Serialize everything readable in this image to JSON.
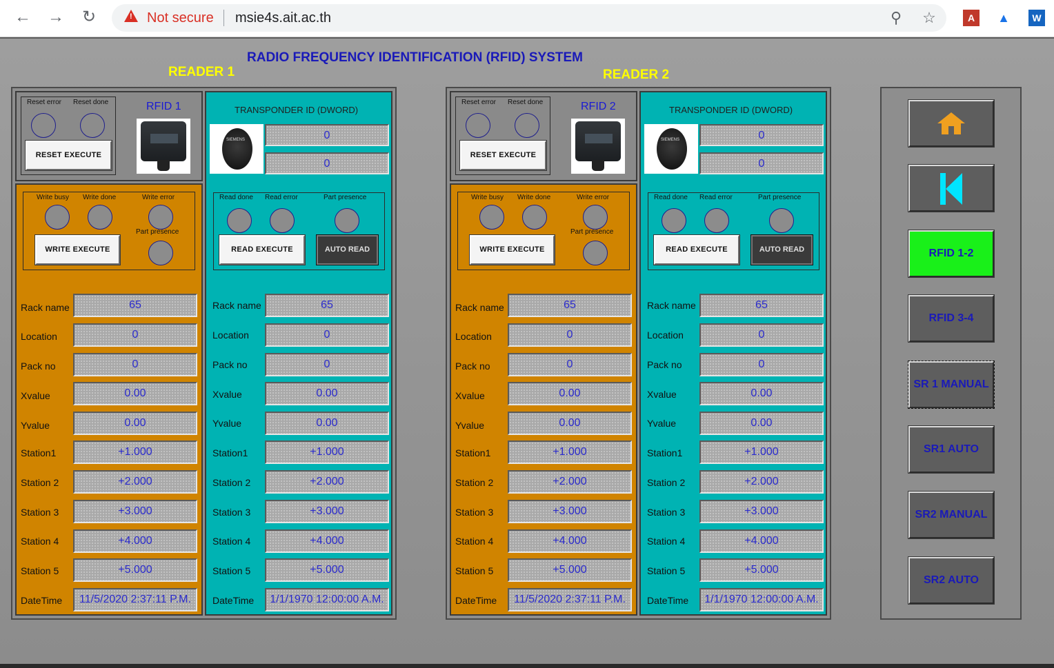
{
  "browser": {
    "back_icon": "back-arrow-icon",
    "forward_icon": "forward-arrow-icon",
    "reload_icon": "reload-icon",
    "security_warning": "Not secure",
    "url": "msie4s.ait.ac.th"
  },
  "hmi": {
    "title": "RADIO FREQUENCY IDENTIFICATION (RFID) SYSTEM",
    "readers": [
      {
        "title": "READER 1",
        "rfid_label": "RFID 1",
        "reset": {
          "error_label": "Reset error",
          "done_label": "Reset done",
          "button": "RESET EXECUTE"
        },
        "write": {
          "busy_label": "Write busy",
          "done_label": "Write done",
          "error_label": "Write error",
          "presence_label": "Part presence",
          "button": "WRITE EXECUTE"
        },
        "transponder": {
          "title": "TRANSPONDER ID (DWORD)",
          "id1": "0",
          "id2": "0"
        },
        "read": {
          "done_label": "Read done",
          "error_label": "Read error",
          "presence_label": "Part presence",
          "button": "READ EXECUTE",
          "auto_button": "AUTO READ"
        },
        "write_fields": [
          {
            "label": "Rack name",
            "value": "65"
          },
          {
            "label": "Location",
            "value": "0"
          },
          {
            "label": "Pack no",
            "value": "0"
          },
          {
            "label": "Xvalue",
            "value": "0.00"
          },
          {
            "label": "Yvalue",
            "value": "0.00"
          },
          {
            "label": "Station1",
            "value": "+1.000"
          },
          {
            "label": "Station 2",
            "value": "+2.000"
          },
          {
            "label": "Station 3",
            "value": "+3.000"
          },
          {
            "label": "Station 4",
            "value": "+4.000"
          },
          {
            "label": "Station 5",
            "value": "+5.000"
          },
          {
            "label": "DateTime",
            "value": "11/5/2020 2:37:11 P.M."
          }
        ],
        "read_fields": [
          {
            "label": "Rack name",
            "value": "65"
          },
          {
            "label": "Location",
            "value": "0"
          },
          {
            "label": "Pack no",
            "value": "0"
          },
          {
            "label": "Xvalue",
            "value": "0.00"
          },
          {
            "label": "Yvalue",
            "value": "0.00"
          },
          {
            "label": "Station1",
            "value": "+1.000"
          },
          {
            "label": "Station 2",
            "value": "+2.000"
          },
          {
            "label": "Station 3",
            "value": "+3.000"
          },
          {
            "label": "Station 4",
            "value": "+4.000"
          },
          {
            "label": "Station 5",
            "value": "+5.000"
          },
          {
            "label": "DateTime",
            "value": "1/1/1970 12:00:00 A.M."
          }
        ]
      },
      {
        "title": "READER 2",
        "rfid_label": "RFID 2",
        "reset": {
          "error_label": "Reset error",
          "done_label": "Reset done",
          "button": "RESET EXECUTE"
        },
        "write": {
          "busy_label": "Write busy",
          "done_label": "Write done",
          "error_label": "Write error",
          "presence_label": "Part presence",
          "button": "WRITE EXECUTE"
        },
        "transponder": {
          "title": "TRANSPONDER ID (DWORD)",
          "id1": "0",
          "id2": "0"
        },
        "read": {
          "done_label": "Read done",
          "error_label": "Read error",
          "presence_label": "Part presence",
          "button": "READ EXECUTE",
          "auto_button": "AUTO READ"
        },
        "write_fields": [
          {
            "label": "Rack name",
            "value": "65"
          },
          {
            "label": "Location",
            "value": "0"
          },
          {
            "label": "Pack no",
            "value": "0"
          },
          {
            "label": "Xvalue",
            "value": "0.00"
          },
          {
            "label": "Yvalue",
            "value": "0.00"
          },
          {
            "label": "Station1",
            "value": "+1.000"
          },
          {
            "label": "Station 2",
            "value": "+2.000"
          },
          {
            "label": "Station 3",
            "value": "+3.000"
          },
          {
            "label": "Station 4",
            "value": "+4.000"
          },
          {
            "label": "Station 5",
            "value": "+5.000"
          },
          {
            "label": "DateTime",
            "value": "11/5/2020 2:37:11 P.M."
          }
        ],
        "read_fields": [
          {
            "label": "Rack name",
            "value": "65"
          },
          {
            "label": "Location",
            "value": "0"
          },
          {
            "label": "Pack no",
            "value": "0"
          },
          {
            "label": "Xvalue",
            "value": "0.00"
          },
          {
            "label": "Yvalue",
            "value": "0.00"
          },
          {
            "label": "Station1",
            "value": "+1.000"
          },
          {
            "label": "Station 2",
            "value": "+2.000"
          },
          {
            "label": "Station 3",
            "value": "+3.000"
          },
          {
            "label": "Station 4",
            "value": "+4.000"
          },
          {
            "label": "Station 5",
            "value": "+5.000"
          },
          {
            "label": "DateTime",
            "value": "1/1/1970 12:00:00 A.M."
          }
        ]
      }
    ],
    "nav": {
      "home_icon": "home-icon",
      "back_icon": "skip-back-icon",
      "items": [
        "RFID 1-2",
        "RFID 3-4",
        "SR 1 MANUAL",
        "SR1 AUTO",
        "SR2 MANUAL",
        "SR2 AUTO"
      ],
      "active": "RFID 1-2"
    },
    "colors": {
      "title_blue": "#1a1ab8",
      "reader_title_yellow": "#ffff00",
      "write_panel_orange": "#d08400",
      "read_panel_teal": "#00b3b3",
      "active_nav_green": "#19f019",
      "home_icon_orange": "#f0a020",
      "back_icon_cyan": "#00e5ff"
    }
  }
}
